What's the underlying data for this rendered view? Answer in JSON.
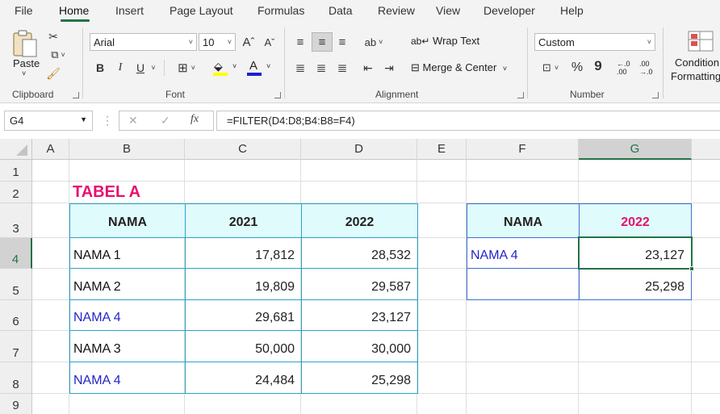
{
  "menu": {
    "tabs": [
      "File",
      "Home",
      "Insert",
      "Page Layout",
      "Formulas",
      "Data",
      "Review",
      "View",
      "Developer",
      "Help"
    ],
    "active": "Home"
  },
  "ribbon": {
    "clipboard": {
      "paste_label": "Paste",
      "group_label": "Clipboard"
    },
    "font": {
      "name": "Arial",
      "size": "10",
      "group_label": "Font",
      "grow": "A^",
      "shrink": "A˅",
      "bold": "B",
      "italic": "I",
      "underline": "U"
    },
    "alignment": {
      "wrap_text": "Wrap Text",
      "merge_center": "Merge & Center",
      "group_label": "Alignment"
    },
    "number": {
      "format": "Custom",
      "percent": "%",
      "comma": "9",
      "group_label": "Number",
      "inc_decimal": "←.0\n.00",
      "dec_decimal": ".00\n→.0"
    },
    "styles": {
      "conditional_formatting_line1": "Condition",
      "conditional_formatting_line2": "Formatting"
    }
  },
  "formula_bar": {
    "name_box": "G4",
    "formula": "=FILTER(D4:D8;B4:B8=F4)",
    "fx": "fx",
    "cancel": "✕",
    "enter": "✓"
  },
  "sheet": {
    "columns": [
      "A",
      "B",
      "C",
      "D",
      "E",
      "F",
      "G"
    ],
    "rows": [
      "1",
      "2",
      "3",
      "4",
      "5",
      "6",
      "7",
      "8",
      "9"
    ],
    "selected_cell": "G4",
    "title": "TABEL A",
    "table_a": {
      "headers": [
        "NAMA",
        "2021",
        "2022"
      ],
      "rows": [
        {
          "nama": "NAMA 1",
          "y2021": "17,812",
          "y2022": "28,532",
          "nama_color": "#111111"
        },
        {
          "nama": "NAMA 2",
          "y2021": "19,809",
          "y2022": "29,587",
          "nama_color": "#111111"
        },
        {
          "nama": "NAMA 4",
          "y2021": "29,681",
          "y2022": "23,127",
          "nama_color": "#2424c8"
        },
        {
          "nama": "NAMA 3",
          "y2021": "50,000",
          "y2022": "30,000",
          "nama_color": "#111111"
        },
        {
          "nama": "NAMA 4",
          "y2021": "24,484",
          "y2022": "25,298",
          "nama_color": "#2424c8"
        }
      ]
    },
    "table_b": {
      "headers": [
        "NAMA",
        "2022"
      ],
      "lookup": "NAMA 4",
      "results": [
        "23,127",
        "25,298"
      ]
    }
  },
  "colors": {
    "title_pink": "#e6116e",
    "header_fill": "#e0fbfb",
    "table_border": "#29a3c9",
    "blue_text": "#2424c8",
    "excel_green": "#217346"
  }
}
